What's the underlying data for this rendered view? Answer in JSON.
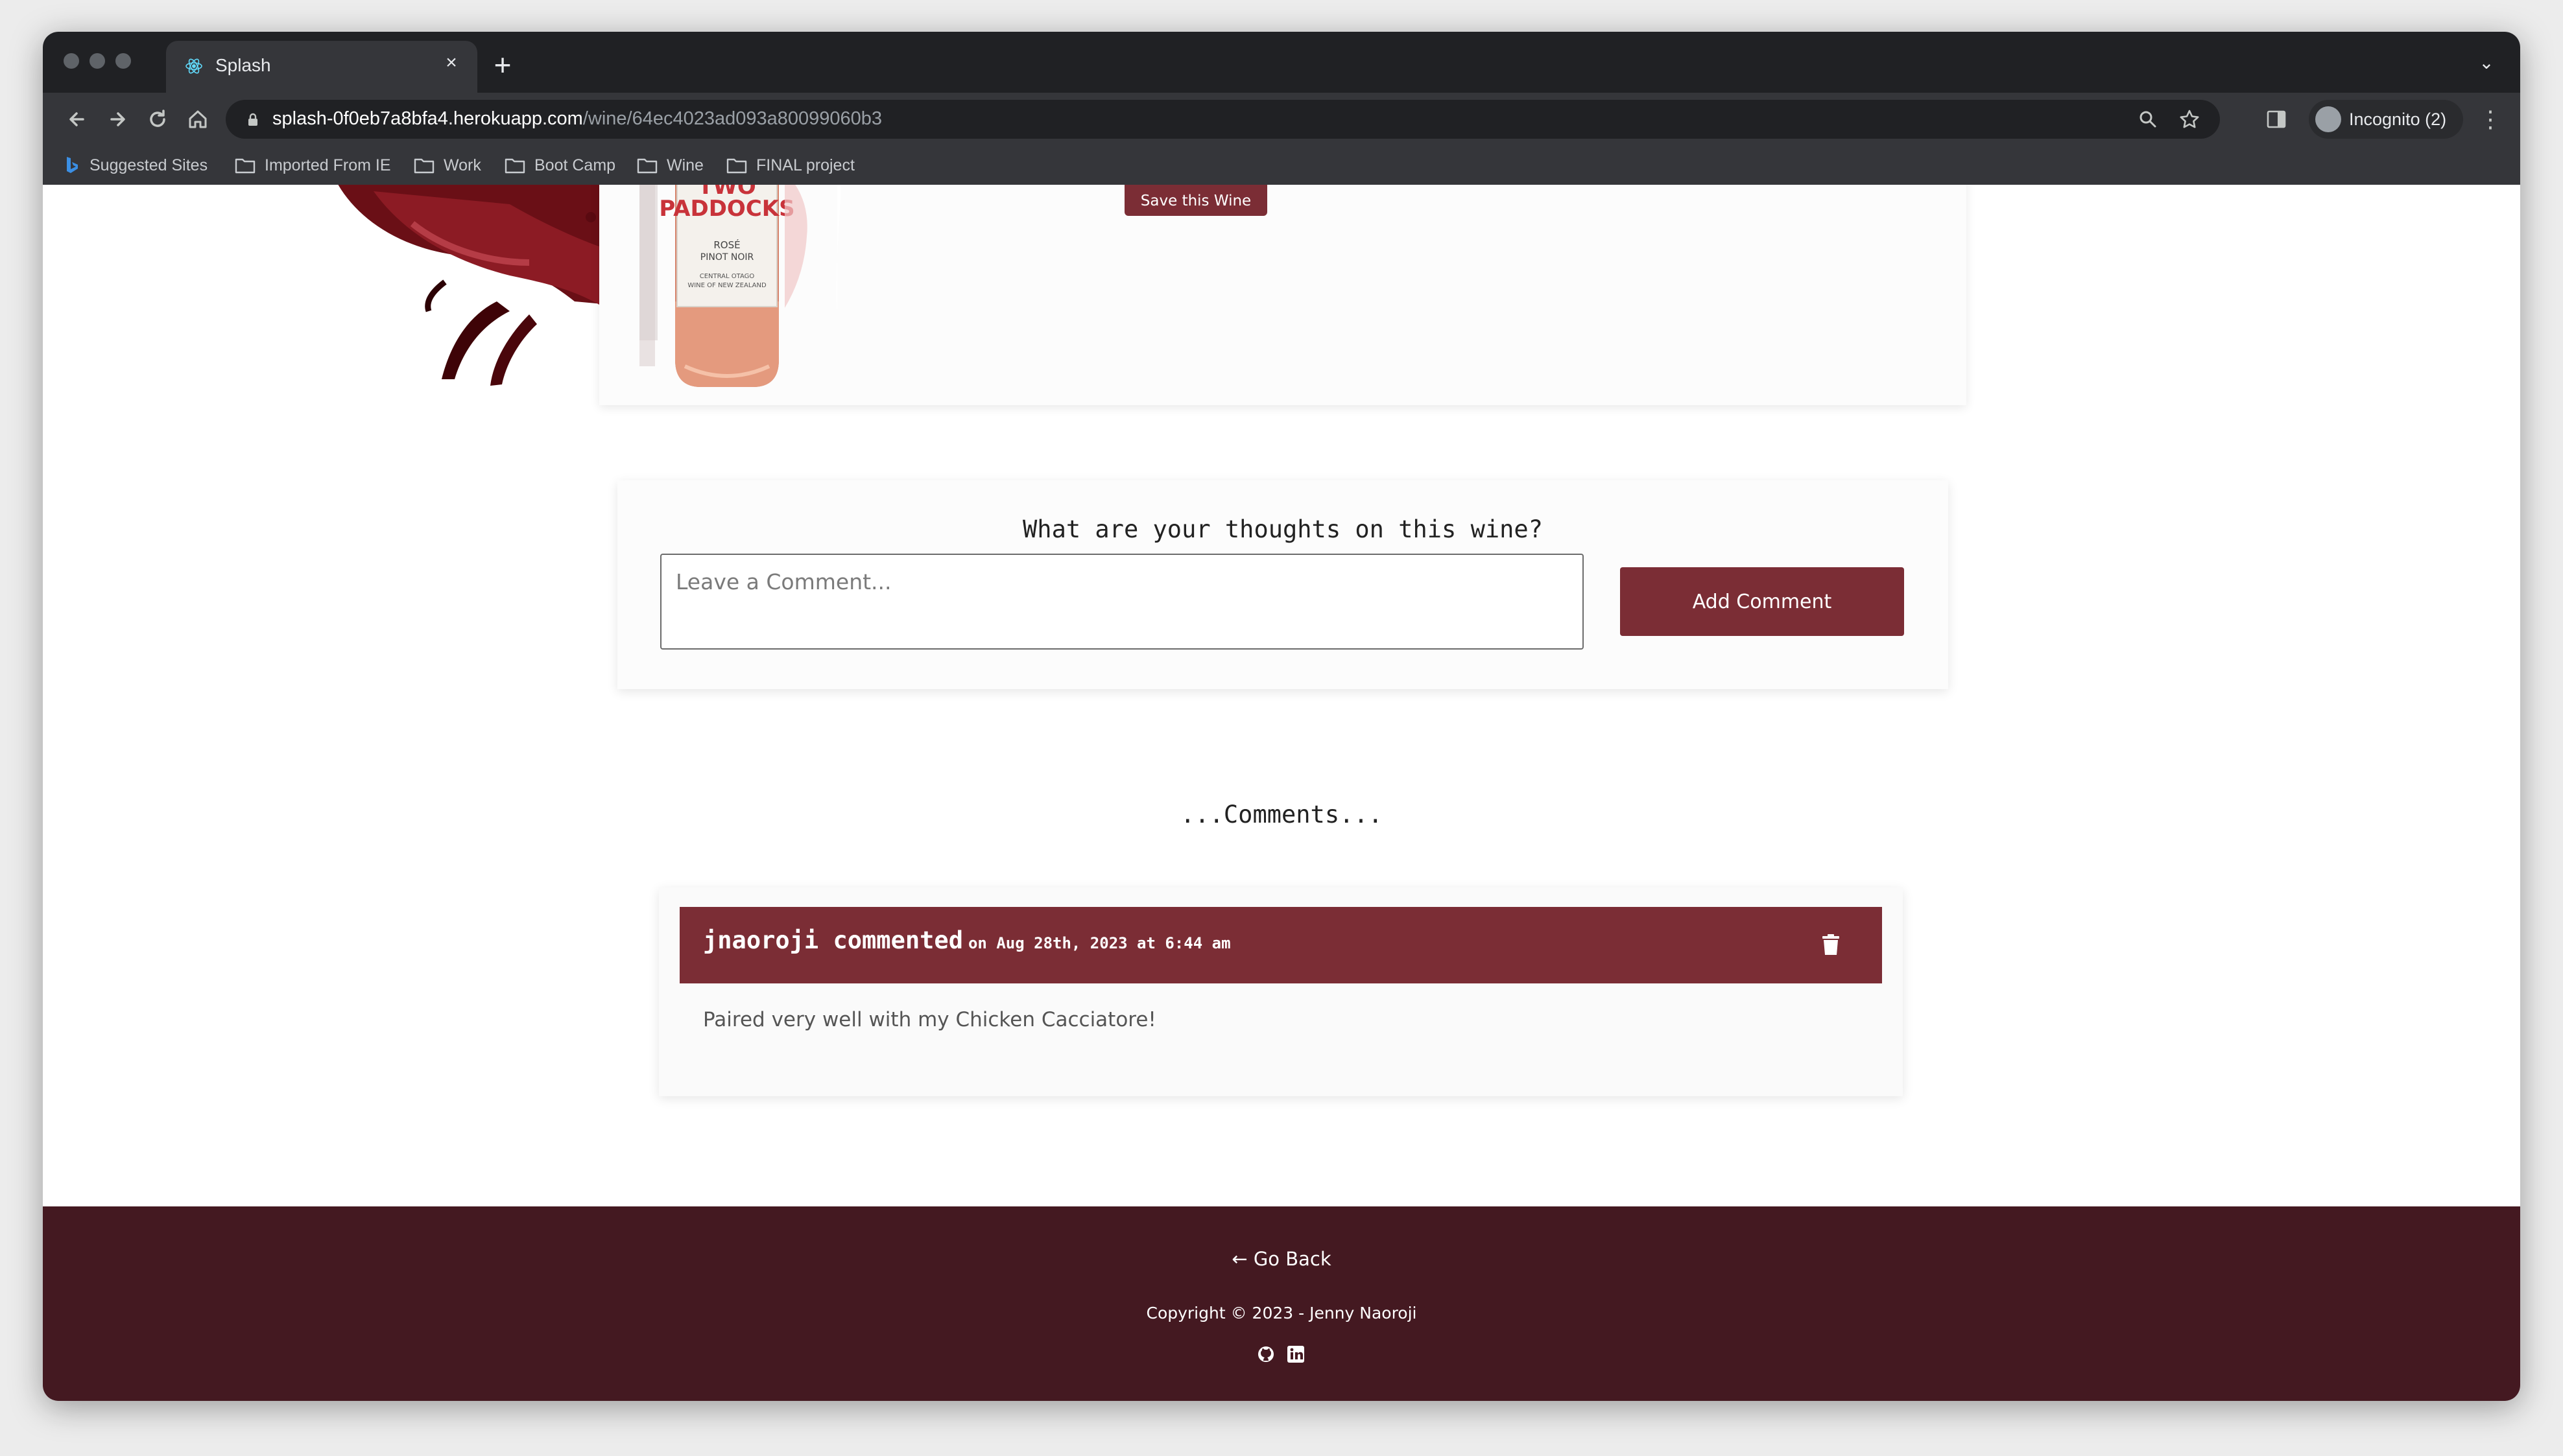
{
  "browser": {
    "tab_title": "Splash",
    "tab_close": "×",
    "new_tab": "+",
    "tab_menu": "⌄",
    "url_host": "splash-0f0eb7a8bfa4.herokuapp.com",
    "url_path": "/wine/64ec4023ad093a80099060b3",
    "profile_label": "Incognito (2)",
    "icons": {
      "back": "back-arrow-icon",
      "forward": "forward-arrow-icon",
      "reload": "reload-icon",
      "home": "home-icon",
      "search": "magnifier-icon",
      "star": "star-icon",
      "side_panel": "side-panel-icon",
      "menu": "kebab-menu-icon"
    },
    "bookmarks": [
      "Suggested Sites",
      "Imported From IE",
      "Work",
      "Boot Camp",
      "Wine",
      "FINAL project"
    ]
  },
  "wine": {
    "bottle_label": {
      "brand_line1": "TWO",
      "brand_line2": "PADDOCKS",
      "variety_line1": "ROSÉ",
      "variety_line2": "PINOT NOIR",
      "region_line1": "CENTRAL OTAGO",
      "region_line2": "WINE OF NEW ZEALAND"
    },
    "save_label": "Save this Wine"
  },
  "comment_form": {
    "heading": "What are your thoughts on this wine?",
    "placeholder": "Leave a Comment...",
    "value": "",
    "submit_label": "Add Comment"
  },
  "comments": {
    "heading": "...Comments...",
    "items": [
      {
        "author_line": "jnaoroji commented",
        "date": "on Aug 28th, 2023 at 6:44 am",
        "body": "Paired very well with my Chicken Cacciatore!",
        "delete_icon": "trash-icon"
      }
    ]
  },
  "footer": {
    "go_back": "← Go Back",
    "copyright": "Copyright © 2023 - Jenny Naoroji",
    "social_icons": [
      "github-icon",
      "linkedin-icon"
    ]
  },
  "colors": {
    "brand": "#7b2d35",
    "footer_bg": "#441921",
    "chrome_dark": "#202124",
    "chrome_toolbar": "#35363a"
  }
}
